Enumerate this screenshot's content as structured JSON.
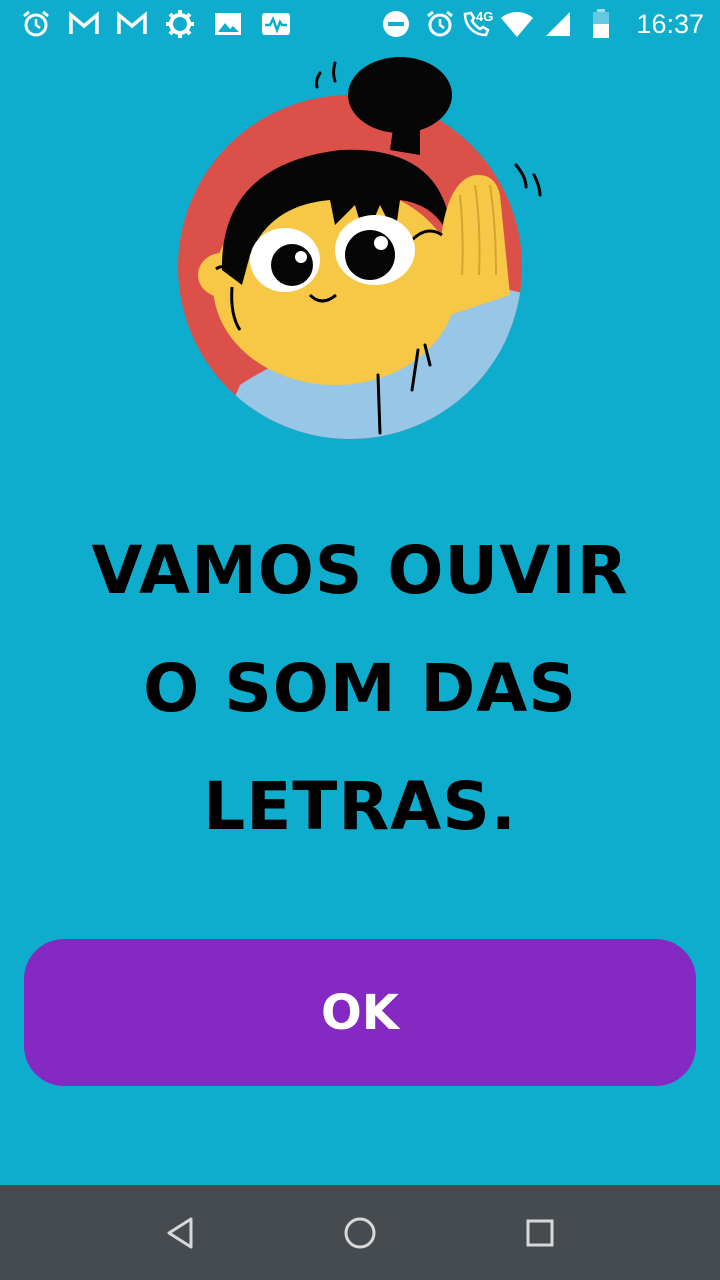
{
  "status_bar": {
    "time": "16:37",
    "network_label": "4G",
    "icons": [
      "alarm-icon",
      "gmail-icon",
      "gmail-icon",
      "settings-icon",
      "image-icon",
      "activity-icon",
      "do-not-disturb-icon",
      "alarm-icon",
      "wifi-call-icon",
      "wifi-icon",
      "signal-icon",
      "battery-icon"
    ]
  },
  "main": {
    "headline_lines": [
      "VAMOS OUVIR",
      "O SOM DAS",
      "LETRAS."
    ],
    "ok_label": "OK"
  },
  "nav_bar": {
    "icons": [
      "back-icon",
      "home-icon",
      "recents-icon"
    ]
  },
  "colors": {
    "background": "#0fadcd",
    "button": "#842ac2",
    "nav_bar": "#464b50"
  }
}
